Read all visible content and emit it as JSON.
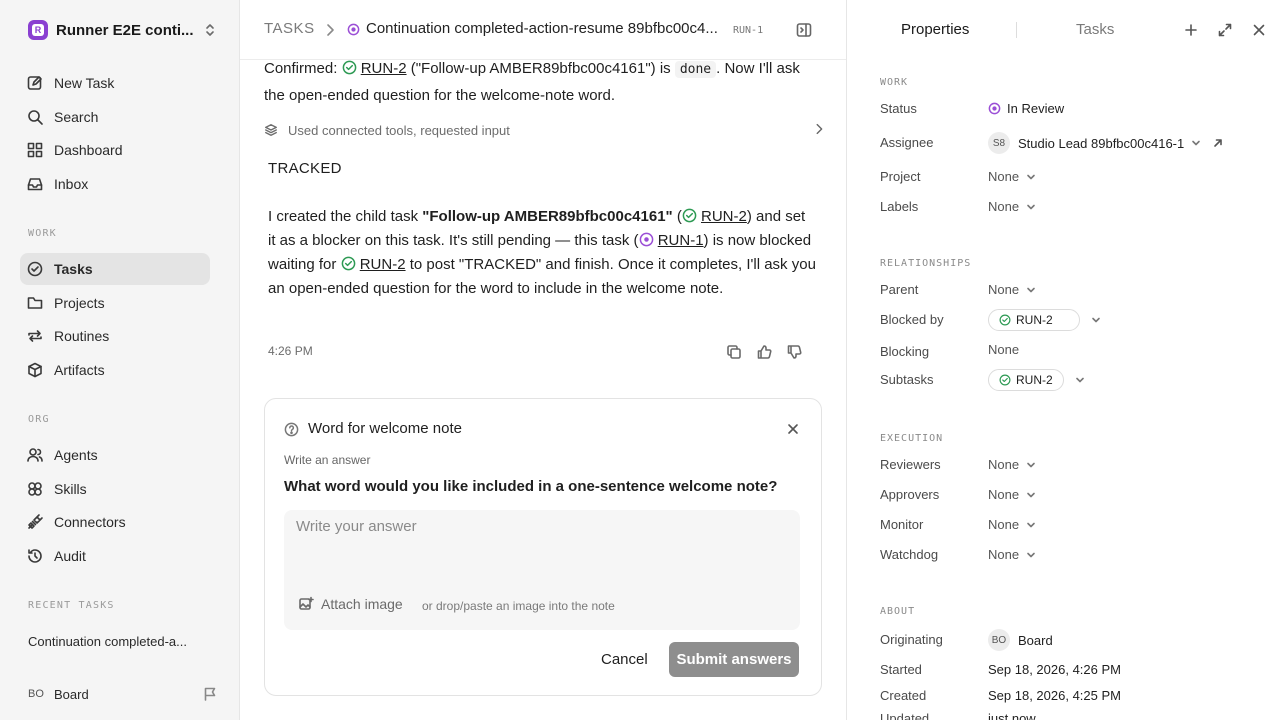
{
  "sidebar": {
    "workspace": "Runner E2E conti...",
    "workspace_logo": "R",
    "nav_primary": [
      {
        "label": "New Task",
        "icon": "edit-icon"
      },
      {
        "label": "Search",
        "icon": "search-icon"
      },
      {
        "label": "Dashboard",
        "icon": "grid-icon"
      },
      {
        "label": "Inbox",
        "icon": "inbox-icon"
      }
    ],
    "work_label": "WORK",
    "nav_work": [
      {
        "label": "Tasks",
        "icon": "check-circle-icon",
        "active": true
      },
      {
        "label": "Projects",
        "icon": "folder-icon"
      },
      {
        "label": "Routines",
        "icon": "repeat-icon"
      },
      {
        "label": "Artifacts",
        "icon": "box-icon"
      }
    ],
    "org_label": "ORG",
    "nav_org": [
      {
        "label": "Agents",
        "icon": "users-icon"
      },
      {
        "label": "Skills",
        "icon": "layers-icon"
      },
      {
        "label": "Connectors",
        "icon": "plug-icon"
      },
      {
        "label": "Audit",
        "icon": "history-icon"
      }
    ],
    "recent_label": "RECENT TASKS",
    "recent_item": "Continuation completed-a...",
    "user_initials": "BO",
    "user_name": "Board"
  },
  "header": {
    "root": "TASKS",
    "title": "Continuation completed-action-resume 89bfbc00c4...",
    "task_id": "RUN-1"
  },
  "conversation": {
    "confirm_prefix": "Confirmed:",
    "confirm_link": "RUN-2",
    "confirm_mid": "(\"Follow-up AMBER89bfbc00c4161\") is",
    "confirm_code": "done",
    "confirm_suffix": ". Now I'll ask the open-ended question for the welcome-note word.",
    "tools_label": "Used connected tools, requested input",
    "tracked": "TRACKED",
    "body_1": "I created the child task",
    "body_bold": "\"Follow-up AMBER89bfbc00c4161\"",
    "body_link_1": "RUN-2",
    "body_2": "and set it as a blocker on this task. It's still pending — this task (",
    "body_link_2": "RUN-1",
    "body_3": ") is now blocked waiting for",
    "body_link_3": "RUN-2",
    "body_4": "to post \"TRACKED\" and finish. Once it completes, I'll ask you an open-ended question for the word to include in the welcome note.",
    "time": "4:26 PM"
  },
  "question_card": {
    "title": "Word for welcome note",
    "subtitle": "Write an answer",
    "question": "What word would you like included in a one-sentence welcome note?",
    "placeholder": "Write your answer",
    "attach_label": "Attach image",
    "attach_hint": "or drop/paste an image into the note",
    "cancel_label": "Cancel",
    "submit_label": "Submit answers"
  },
  "properties": {
    "tab_properties": "Properties",
    "tab_tasks": "Tasks",
    "work_section": "WORK",
    "status_label": "Status",
    "status_value": "In Review",
    "assignee_label": "Assignee",
    "assignee_initials": "S8",
    "assignee_value": "Studio Lead 89bfbc00c416-1",
    "project_label": "Project",
    "project_value": "None",
    "labels_label": "Labels",
    "labels_value": "None",
    "rel_section": "RELATIONSHIPS",
    "parent_label": "Parent",
    "parent_value": "None",
    "blocked_by_label": "Blocked by",
    "blocked_by_value": "RUN-2",
    "blocking_label": "Blocking",
    "blocking_value": "None",
    "subtasks_label": "Subtasks",
    "subtasks_value": "RUN-2",
    "exec_section": "EXECUTION",
    "reviewers_label": "Reviewers",
    "reviewers_value": "None",
    "approvers_label": "Approvers",
    "approvers_value": "None",
    "monitor_label": "Monitor",
    "monitor_value": "None",
    "watchdog_label": "Watchdog",
    "watchdog_value": "None",
    "about_section": "ABOUT",
    "originating_label": "Originating",
    "originating_initials": "BO",
    "originating_value": "Board",
    "started_label": "Started",
    "started_value": "Sep 18, 2026, 4:26 PM",
    "created_label": "Created",
    "created_value": "Sep 18, 2026, 4:25 PM",
    "updated_label": "Updated",
    "updated_value": "just now"
  },
  "colors": {
    "accent_purple": "#8a3fd1",
    "done_green": "#2e9a54",
    "review_purple": "#9b4fd6",
    "submit_disabled": "#8e8e8e"
  }
}
